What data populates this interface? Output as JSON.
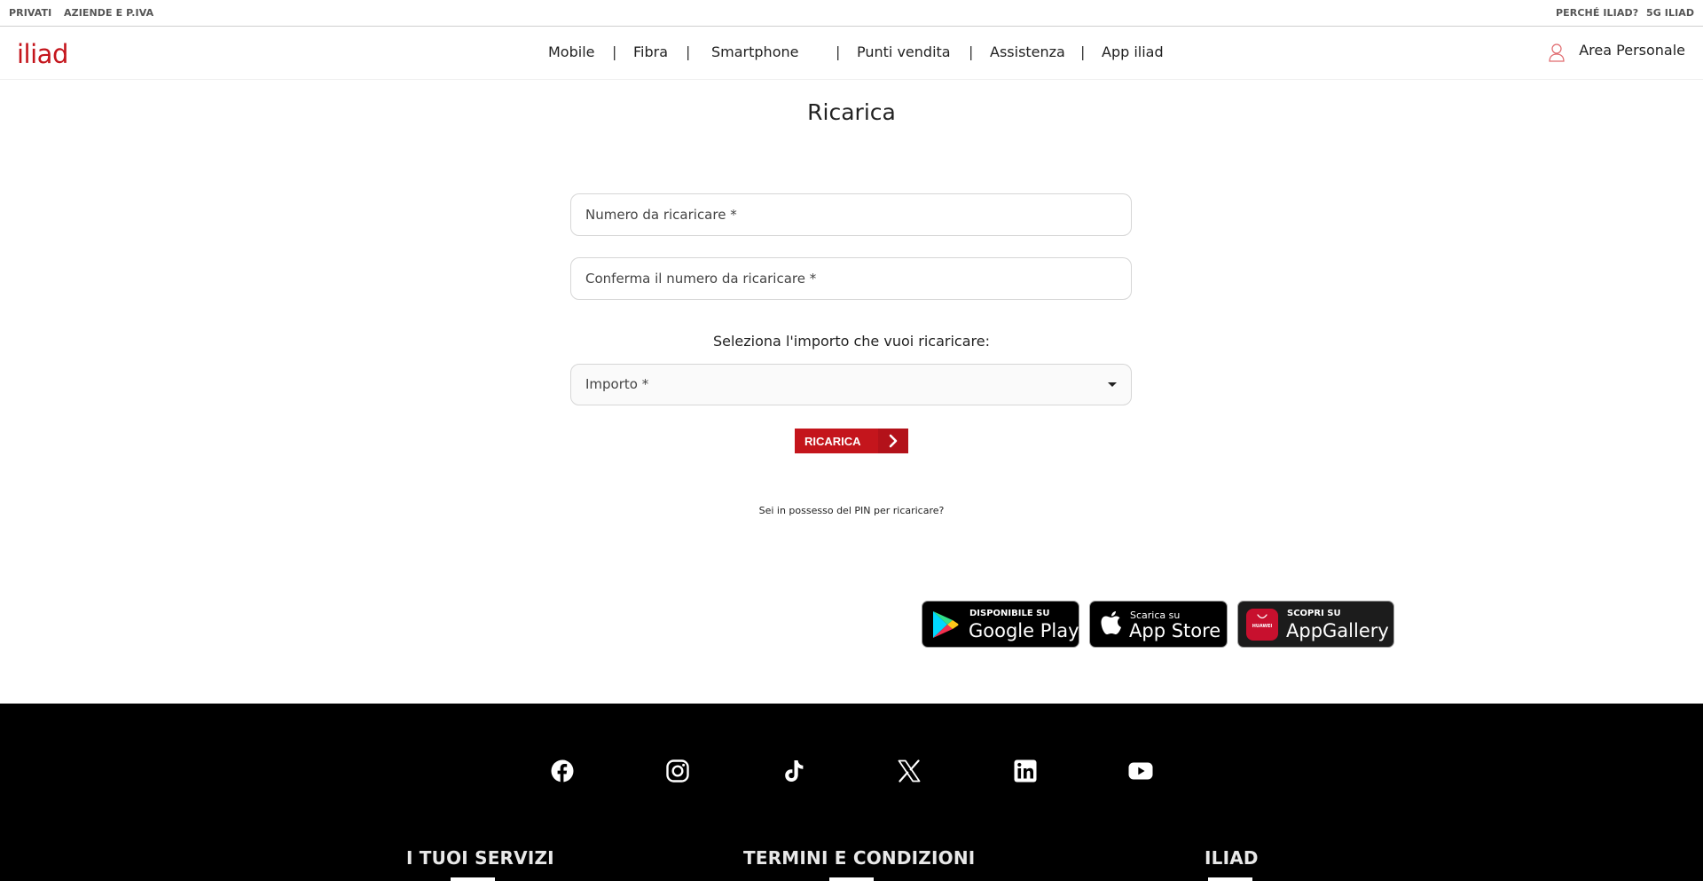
{
  "topbar": {
    "left": [
      "PRIVATI",
      "AZIENDE E P.IVA"
    ],
    "right": [
      "PERCHÉ ILIAD?",
      "5G ILIAD"
    ]
  },
  "header": {
    "logo": "iliad",
    "nav": [
      "Mobile",
      "Fibra",
      "Smartphone",
      "Punti vendita",
      "Assistenza",
      "App iliad"
    ],
    "separator": "|",
    "account_label": "Area Personale"
  },
  "main": {
    "title": "Ricarica",
    "number_placeholder": "Numero da ricaricare *",
    "confirm_placeholder": "Conferma il numero da ricaricare *",
    "amount_prompt": "Seleziona l'importo che vuoi ricaricare:",
    "amount_value": "Importo *",
    "submit_label": "RICARICA",
    "pin_link": "Sei in possesso del PIN per ricaricare?"
  },
  "stores": {
    "google": {
      "small": "DISPONIBILE SU",
      "big": "Google Play"
    },
    "apple": {
      "small": "Scarica su",
      "big": "App Store"
    },
    "huawei": {
      "small": "SCOPRI SU",
      "big": "AppGallery",
      "brand": "HUAWEI"
    }
  },
  "footer": {
    "social_icons": [
      "facebook-icon",
      "instagram-icon",
      "tiktok-icon",
      "x-icon",
      "linkedin-icon",
      "youtube-icon"
    ],
    "sections": [
      "I TUOI SERVIZI",
      "TERMINI E CONDIZIONI",
      "ILIAD"
    ]
  },
  "colors": {
    "brand_red": "#c4151c",
    "footer_bg": "#000000"
  }
}
